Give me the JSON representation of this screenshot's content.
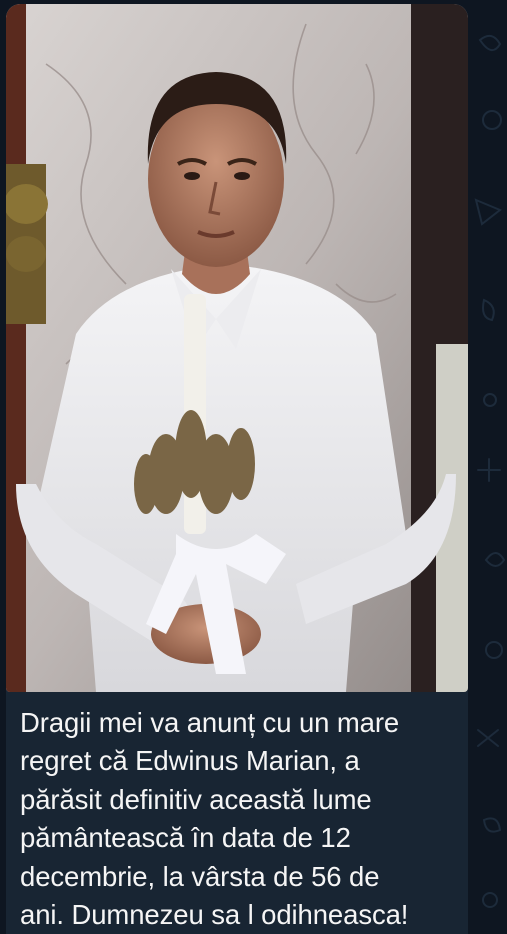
{
  "message": {
    "photo": {
      "alt_icon": "memorial-photo",
      "subject": "man-holding-candle-icon"
    },
    "caption": "Dragii mei va anunț cu un mare\nregret că Edwinus Marian, a\npărăsit definitiv această lume\npământească în data de 12\ndecembrie, la vârsta de 56 de\nani. Dumnezeu sa l odihneasca!"
  },
  "colors": {
    "chat_background": "#0e1621",
    "bubble_background": "#182533",
    "caption_text": "#f5f5f5"
  }
}
